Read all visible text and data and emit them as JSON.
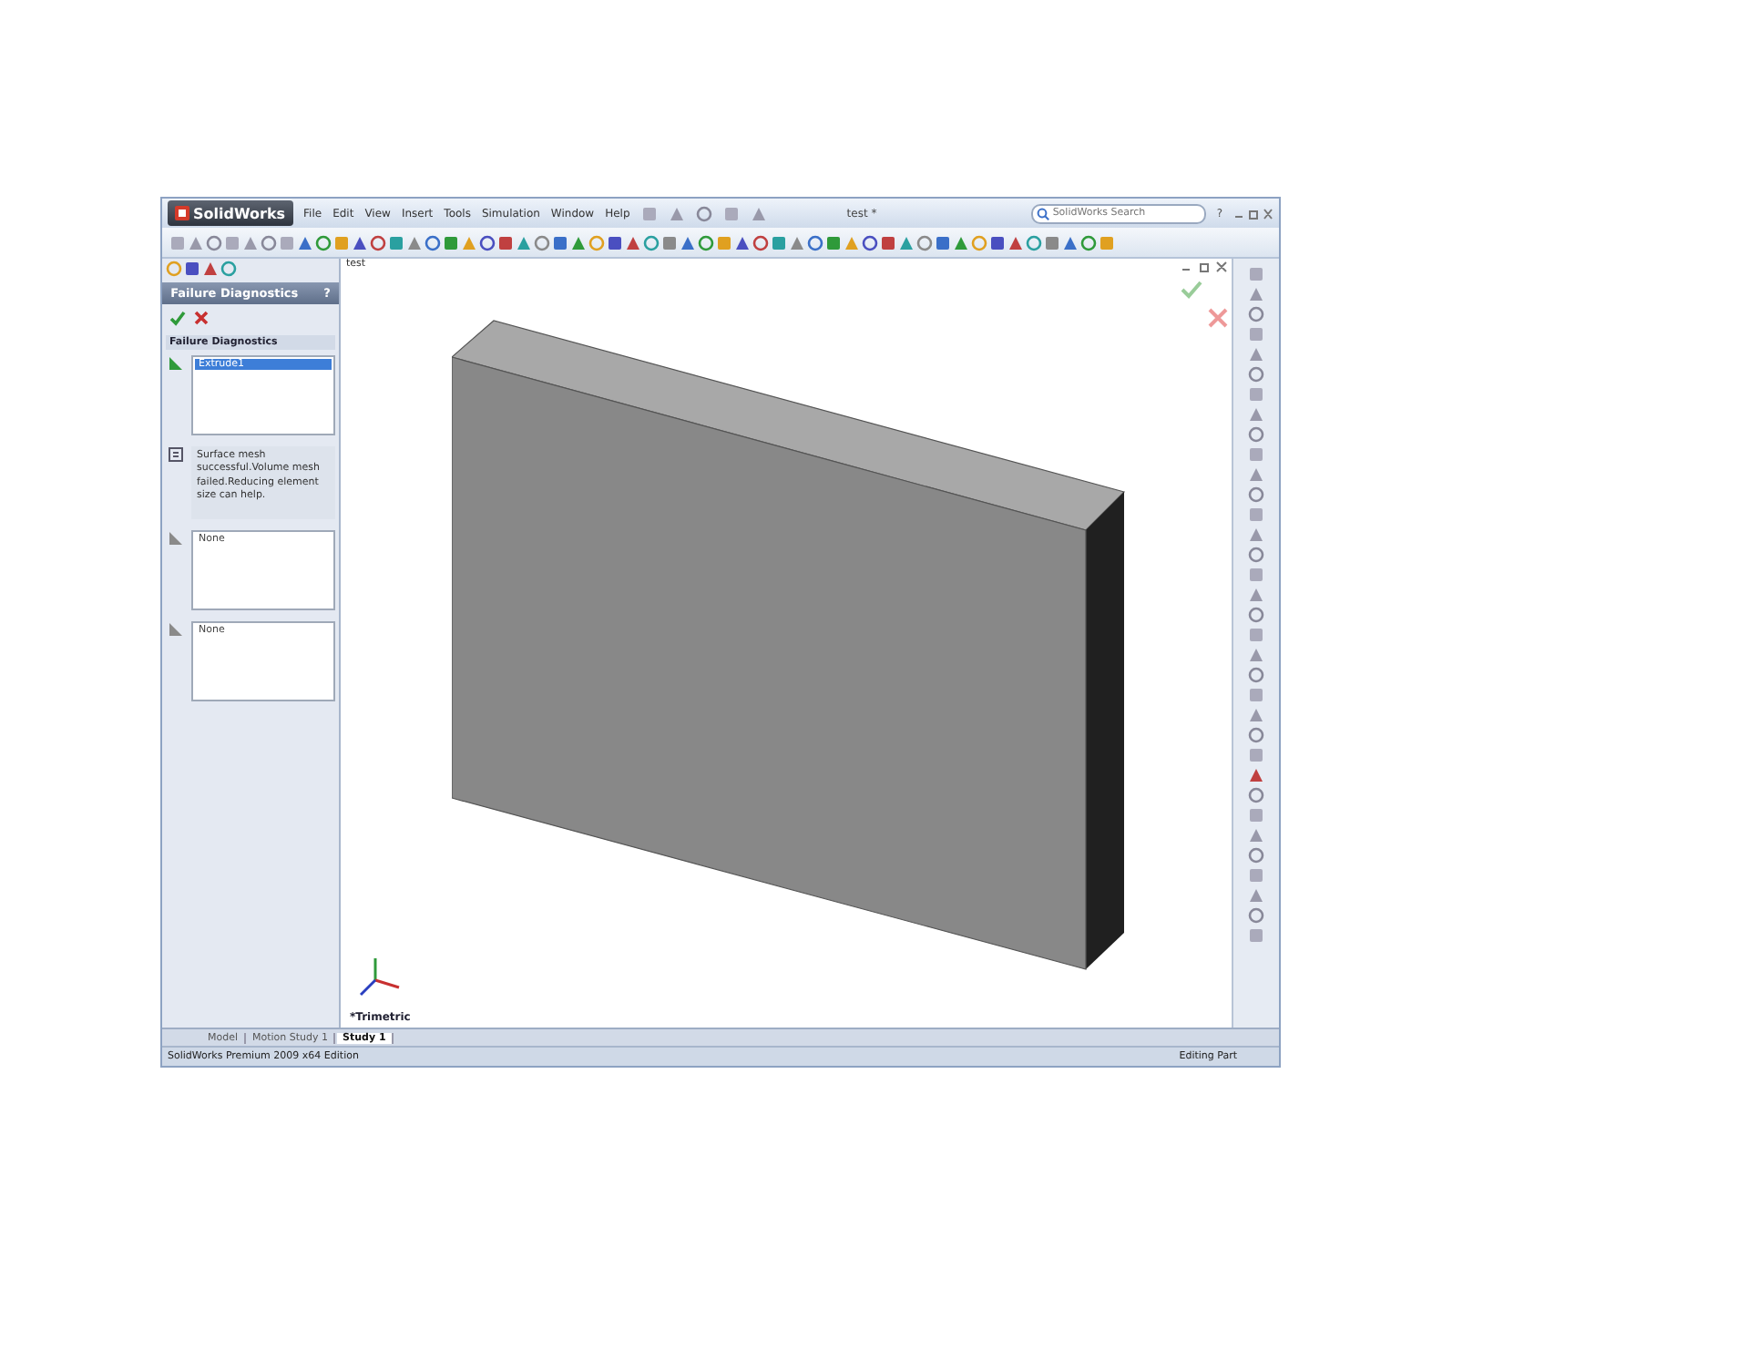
{
  "app": {
    "logo": "SolidWorks",
    "menu": [
      "File",
      "Edit",
      "View",
      "Insert",
      "Tools",
      "Simulation",
      "Window",
      "Help"
    ],
    "document_title": "test *",
    "search": {
      "placeholder": "SolidWorks Search"
    },
    "help_mark": "?"
  },
  "tree": {
    "root": "test"
  },
  "panel": {
    "title": "Failure Diagnostics",
    "help": "?",
    "section": "Failure Diagnostics",
    "groups": [
      {
        "kind": "list",
        "items": [
          {
            "label": "Extrude1",
            "selected": true
          }
        ]
      },
      {
        "kind": "message",
        "text": "Surface mesh successful.Volume mesh failed.Reducing element size can help."
      },
      {
        "kind": "list",
        "items": [
          {
            "label": "None",
            "selected": false
          }
        ]
      },
      {
        "kind": "list",
        "items": [
          {
            "label": "None",
            "selected": false
          }
        ]
      }
    ]
  },
  "viewport": {
    "view_label": "*Trimetric"
  },
  "tabs": [
    {
      "label": "Model",
      "selected": false
    },
    {
      "label": "Motion Study 1",
      "selected": false
    },
    {
      "label": "Study 1",
      "selected": true
    }
  ],
  "status_bar": {
    "product": "SolidWorks Premium 2009 x64 Edition",
    "mode": "Editing Part"
  }
}
